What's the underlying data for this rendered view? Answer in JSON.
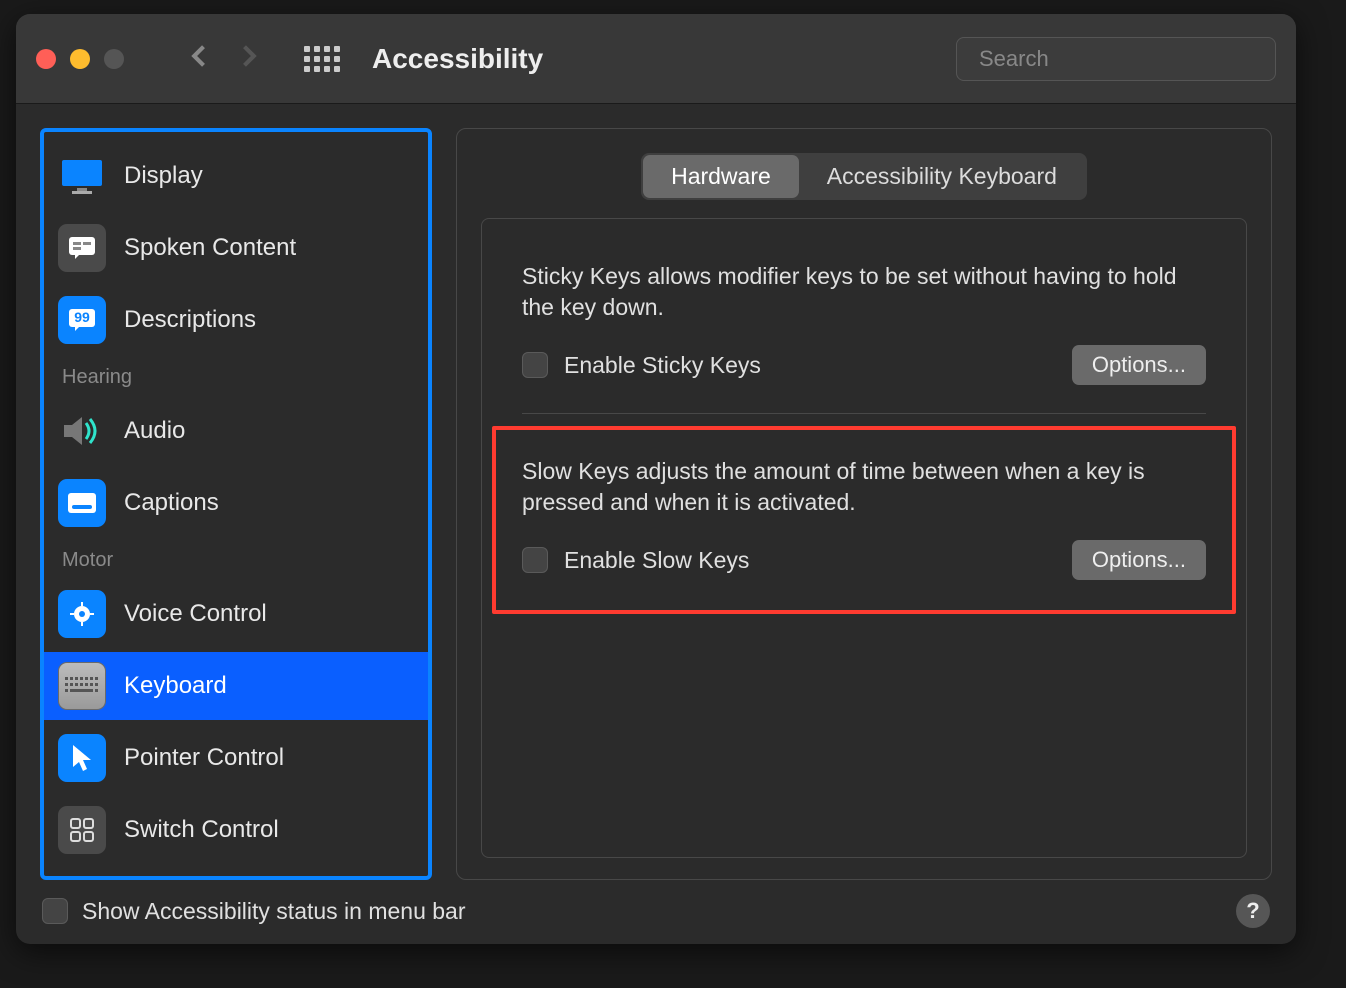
{
  "header": {
    "title": "Accessibility",
    "search_placeholder": "Search"
  },
  "sidebar": {
    "items": [
      {
        "label": "Display"
      },
      {
        "label": "Spoken Content"
      },
      {
        "label": "Descriptions"
      }
    ],
    "hearing_header": "Hearing",
    "hearing_items": [
      {
        "label": "Audio"
      },
      {
        "label": "Captions"
      }
    ],
    "motor_header": "Motor",
    "motor_items": [
      {
        "label": "Voice Control"
      },
      {
        "label": "Keyboard"
      },
      {
        "label": "Pointer Control"
      },
      {
        "label": "Switch Control"
      }
    ]
  },
  "tabs": {
    "hardware": "Hardware",
    "accessibility_keyboard": "Accessibility Keyboard"
  },
  "sticky": {
    "desc": "Sticky Keys allows modifier keys to be set without having to hold the key down.",
    "enable_label": "Enable Sticky Keys",
    "options_label": "Options..."
  },
  "slow": {
    "desc": "Slow Keys adjusts the amount of time between when a key is pressed and when it is activated.",
    "enable_label": "Enable Slow Keys",
    "options_label": "Options..."
  },
  "footer": {
    "show_status_label": "Show Accessibility status in menu bar",
    "help": "?"
  }
}
